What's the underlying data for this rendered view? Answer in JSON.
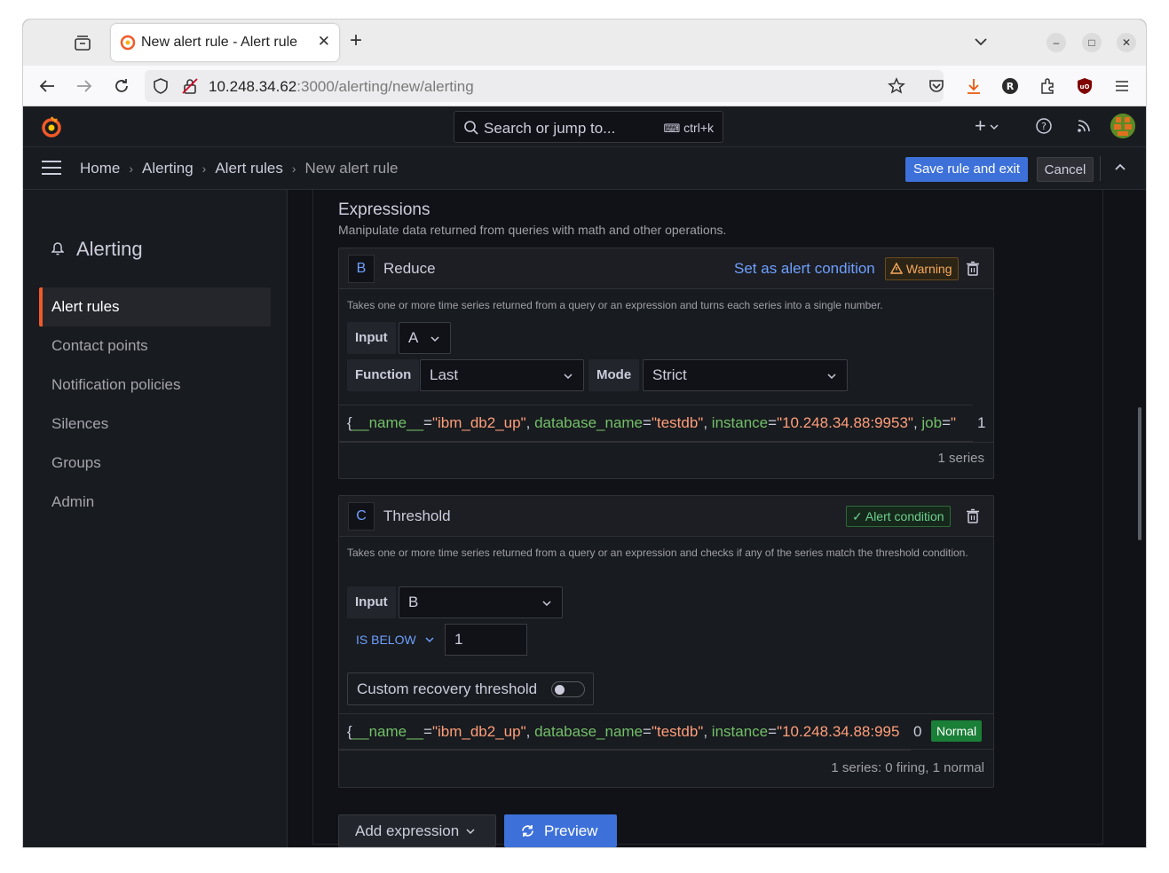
{
  "browser": {
    "tab_title": "New alert rule - Alert rule",
    "url_host": "10.248.34.62",
    "url_rest": ":3000/alerting/new/alerting"
  },
  "grafana": {
    "search_placeholder": "Search or jump to...",
    "search_shortcut": "ctrl+k",
    "breadcrumbs": [
      "Home",
      "Alerting",
      "Alert rules",
      "New alert rule"
    ],
    "save_button": "Save rule and exit",
    "cancel_button": "Cancel"
  },
  "sidebar": {
    "title": "Alerting",
    "items": [
      {
        "label": "Alert rules",
        "active": true
      },
      {
        "label": "Contact points",
        "active": false
      },
      {
        "label": "Notification policies",
        "active": false
      },
      {
        "label": "Silences",
        "active": false
      },
      {
        "label": "Groups",
        "active": false
      },
      {
        "label": "Admin",
        "active": false
      }
    ]
  },
  "main": {
    "section_title": "Expressions",
    "section_subtitle": "Manipulate data returned from queries with math and other operations.",
    "reduce": {
      "ref": "B",
      "name": "Reduce",
      "set_condition_link": "Set as alert condition",
      "warning_badge": "Warning",
      "description": "Takes one or more time series returned from a query or an expression and turns each series into a single number.",
      "input_label": "Input",
      "input_value": "A",
      "function_label": "Function",
      "function_value": "Last",
      "mode_label": "Mode",
      "mode_value": "Strict",
      "series": {
        "k1": "__name__",
        "v1": "\"ibm_db2_up\"",
        "k2": "database_name",
        "v2": "\"testdb\"",
        "k3": "instance",
        "v3": "\"10.248.34.88:9953\"",
        "k4": "job",
        "v4": "\"",
        "value": "1"
      },
      "footer": "1 series"
    },
    "threshold": {
      "ref": "C",
      "name": "Threshold",
      "condition_badge": "Alert condition",
      "description": "Takes one or more time series returned from a query or an expression and checks if any of the series match the threshold condition.",
      "input_label": "Input",
      "input_value": "B",
      "operator": "IS BELOW",
      "threshold_value": "1",
      "recovery_label": "Custom recovery threshold",
      "series": {
        "k1": "__name__",
        "v1": "\"ibm_db2_up\"",
        "k2": "database_name",
        "v2": "\"testdb\"",
        "k3": "instance",
        "v3": "\"10.248.34.88:995",
        "value": "0",
        "state": "Normal"
      },
      "footer": "1 series: 0 firing, 1 normal"
    },
    "add_expression_button": "Add expression",
    "preview_button": "Preview"
  },
  "colors": {
    "accent": "#3d71d9",
    "active_border": "#f05a28",
    "label_key": "#73bf69",
    "label_value": "#ff9e7a",
    "normal": "#1a7f37"
  }
}
